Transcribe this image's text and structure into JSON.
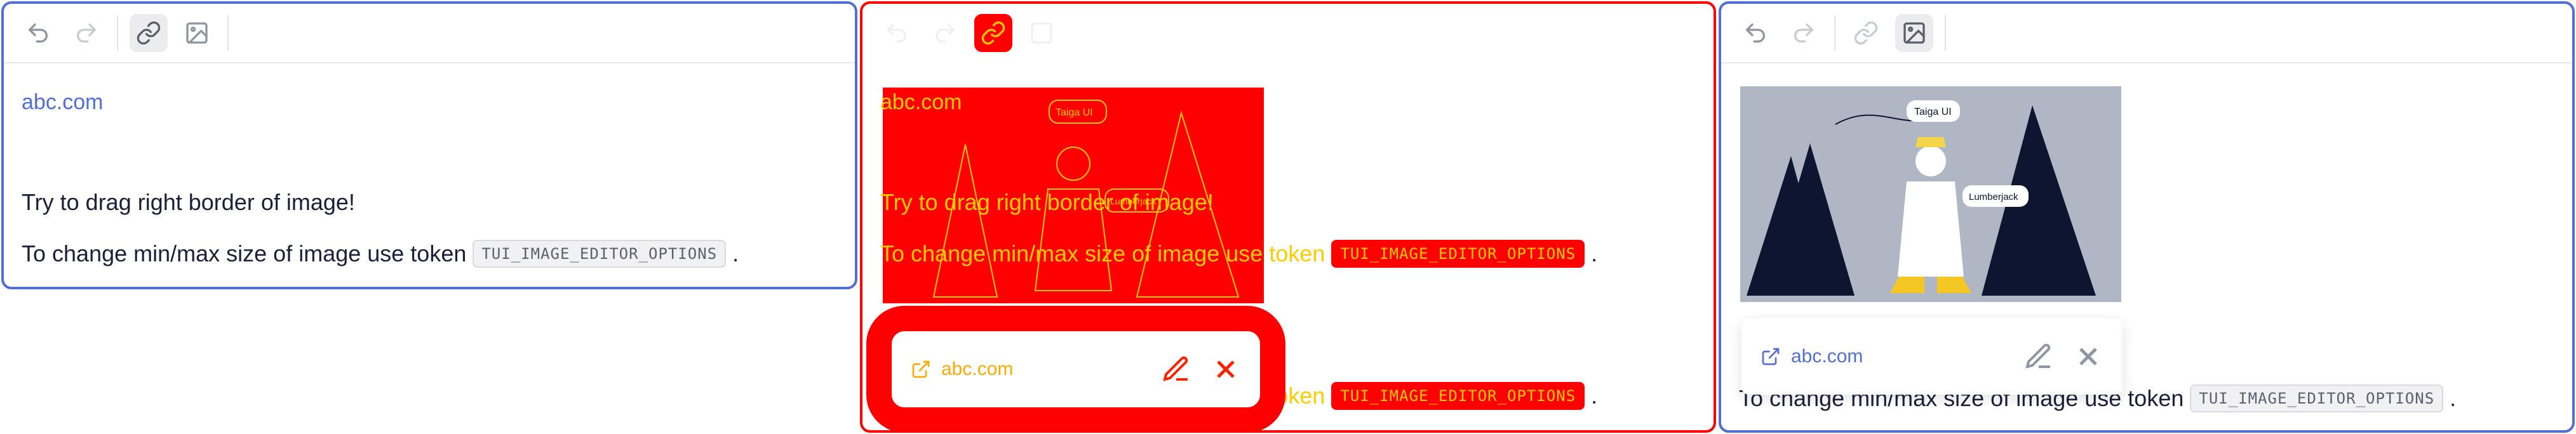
{
  "toolbar": {
    "undo_icon": "undo-icon",
    "redo_icon": "redo-icon",
    "link_icon": "link-icon",
    "image_icon": "image-icon"
  },
  "content": {
    "link_text": "abc.com",
    "paragraph1": "Try to drag right border of image!",
    "paragraph2_prefix": "To change min/max size of image use token",
    "token": "TUI_IMAGE_EDITOR_OPTIONS",
    "paragraph2_suffix": "."
  },
  "illustration": {
    "label_top": "Taiga UI",
    "label_bottom": "Lumberjack"
  },
  "link_popup": {
    "url": "abc.com"
  },
  "colors": {
    "accent": "#526ed3",
    "highlight": "#ff0000",
    "highlight_text": "#ffcc00"
  }
}
